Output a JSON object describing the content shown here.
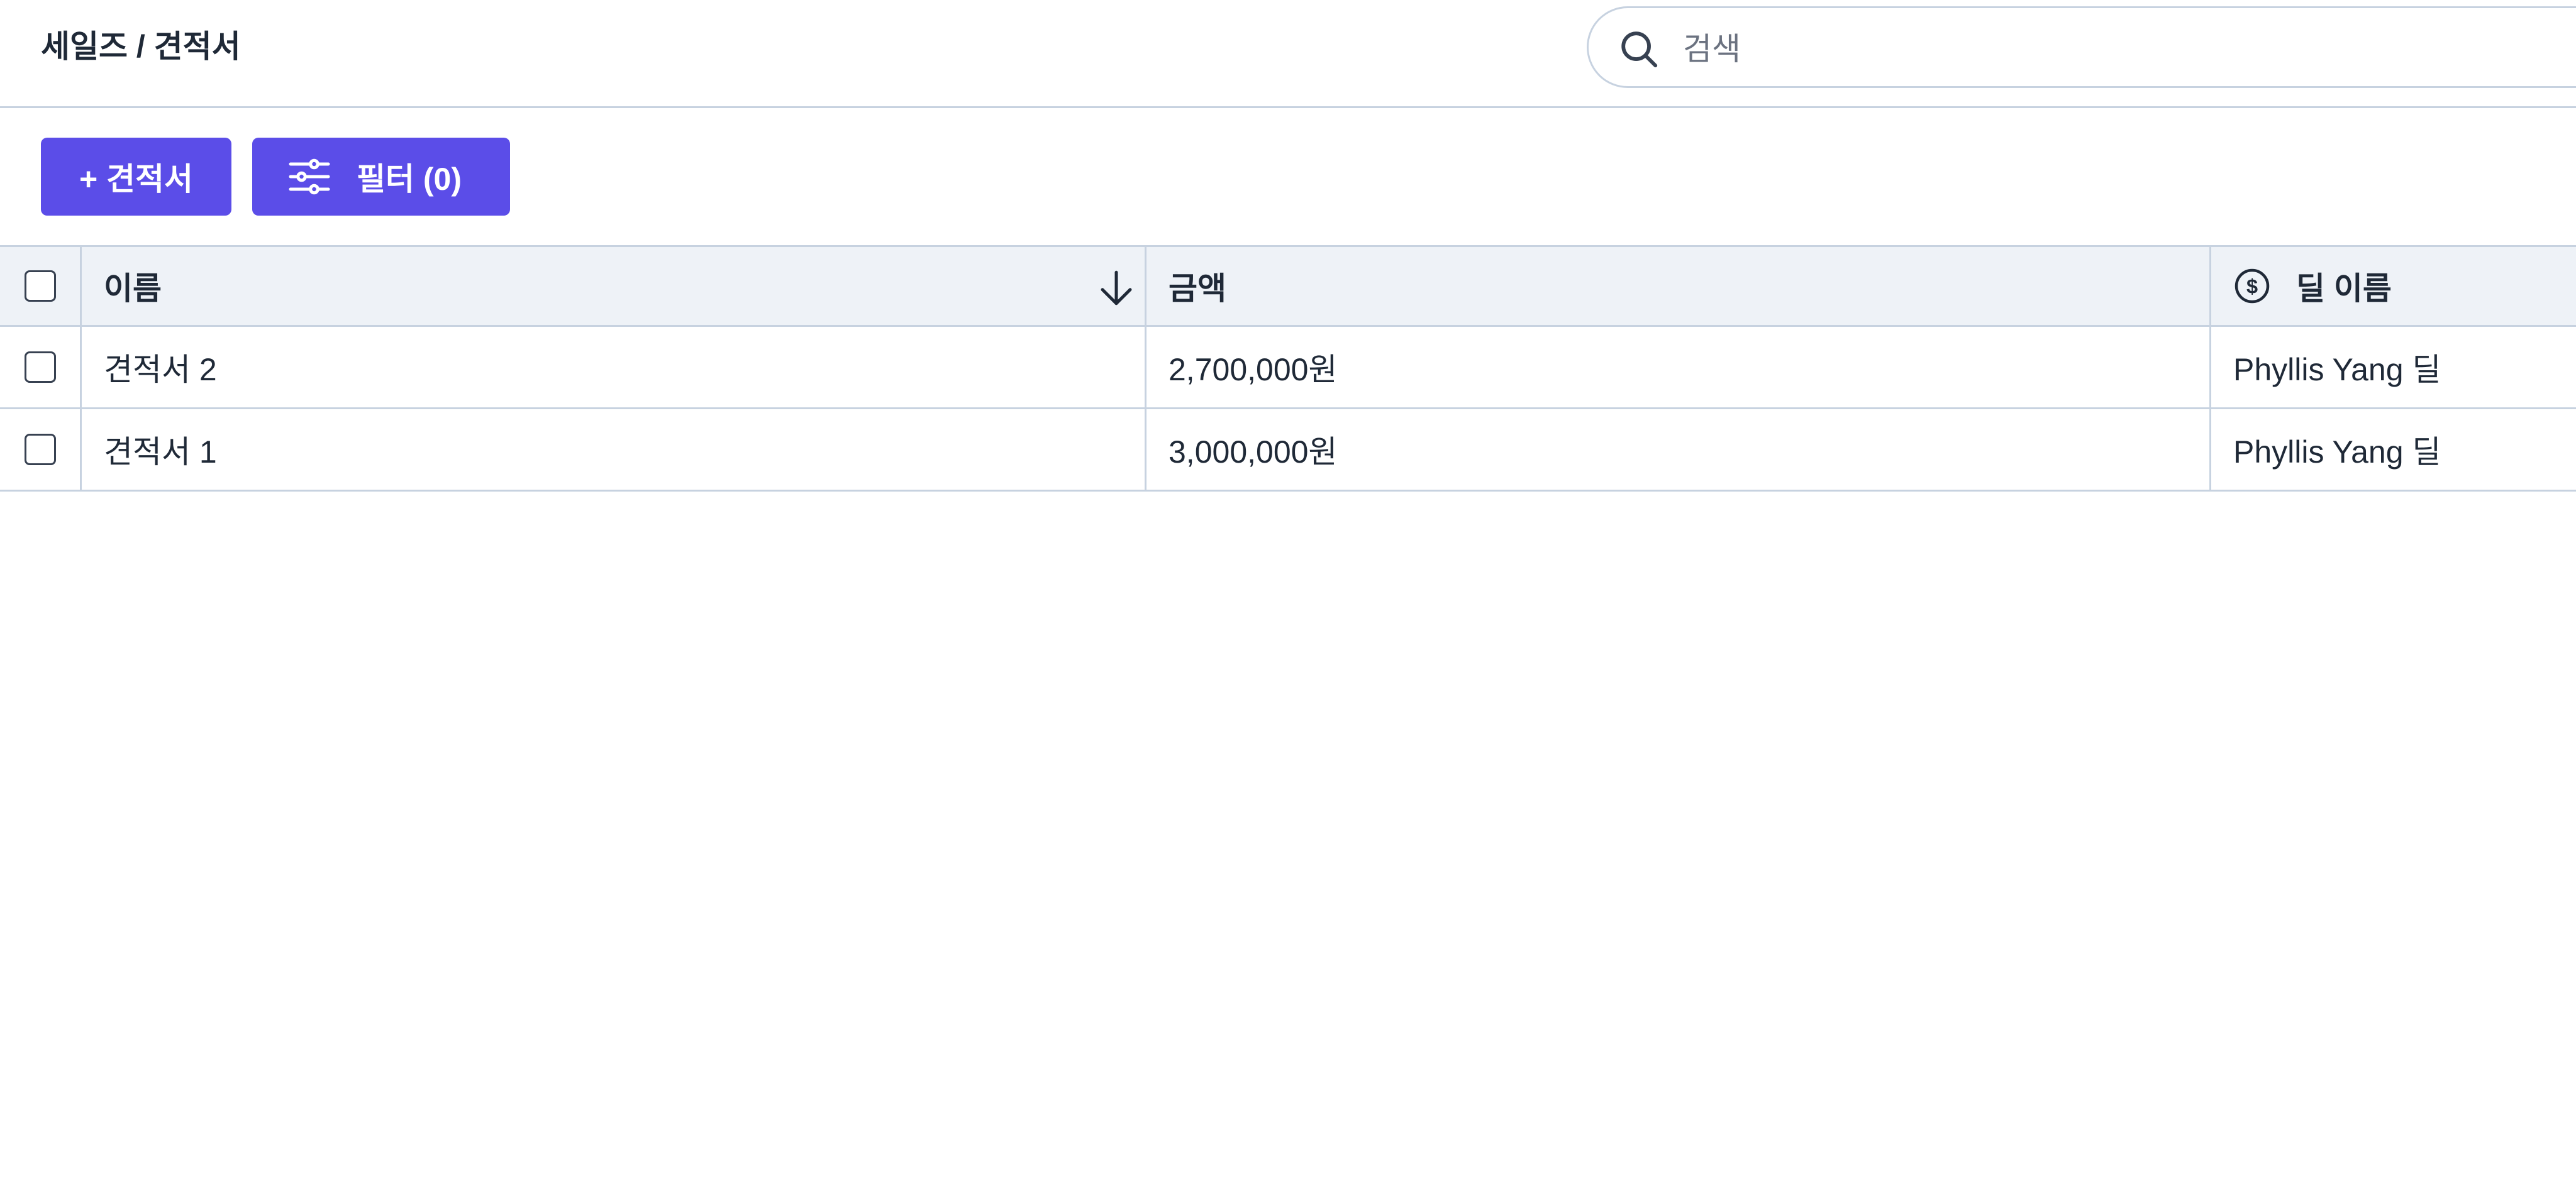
{
  "header": {
    "breadcrumb": "세일즈 / 견적서",
    "search": {
      "placeholder": "검색",
      "value": ""
    }
  },
  "toolbar": {
    "add_label": "+ 견적서",
    "filter_label": "필터 (0)"
  },
  "table": {
    "columns": {
      "name": "이름",
      "amount": "금액",
      "deal": "딜 이름"
    },
    "rows": [
      {
        "name": "견적서 2",
        "amount": "2,700,000원",
        "deal": "Phyllis Yang 딜"
      },
      {
        "name": "견적서 1",
        "amount": "3,000,000원",
        "deal": "Phyllis Yang 딜"
      }
    ]
  },
  "colors": {
    "accent": "#5b4de8",
    "border": "#c7d2e0",
    "header_bg": "#eef2f7"
  },
  "icons": {
    "search": "search-icon",
    "filter": "sliders-icon",
    "sort": "arrow-down-icon",
    "deal": "dollar-circle-icon"
  }
}
